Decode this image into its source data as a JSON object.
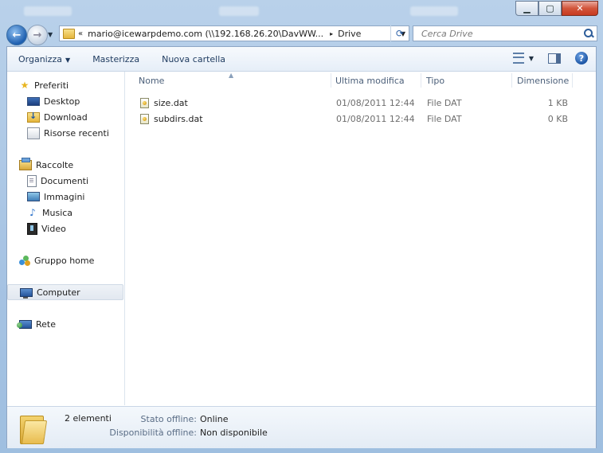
{
  "address": {
    "path_prefix": "«",
    "path": "mario@icewarpdemo.com (\\\\192.168.26.20\\DavWW...",
    "separator": "▸",
    "current": "Drive"
  },
  "search": {
    "placeholder": "Cerca Drive"
  },
  "toolbar": {
    "organize": "Organizza",
    "burn": "Masterizza",
    "new_folder": "Nuova cartella"
  },
  "nav": {
    "favorites": "Preferiti",
    "desktop": "Desktop",
    "download": "Download",
    "recent": "Risorse recenti",
    "libraries": "Raccolte",
    "documents": "Documenti",
    "images": "Immagini",
    "music": "Musica",
    "video": "Video",
    "homegroup": "Gruppo home",
    "computer": "Computer",
    "network": "Rete"
  },
  "columns": {
    "name": "Nome",
    "modified": "Ultima modifica",
    "type": "Tipo",
    "size": "Dimensione"
  },
  "files": [
    {
      "name": "size.dat",
      "modified": "01/08/2011 12:44",
      "type": "File DAT",
      "size": "1 KB"
    },
    {
      "name": "subdirs.dat",
      "modified": "01/08/2011 12:44",
      "type": "File DAT",
      "size": "0 KB"
    }
  ],
  "details": {
    "count": "2 elementi",
    "offline_label": "Stato offline:",
    "offline_value": "Online",
    "availability_label": "Disponibilità offline:",
    "availability_value": "Non disponibile"
  },
  "caption": {
    "minimize": "▁",
    "maximize": "▢",
    "close": "✕"
  }
}
